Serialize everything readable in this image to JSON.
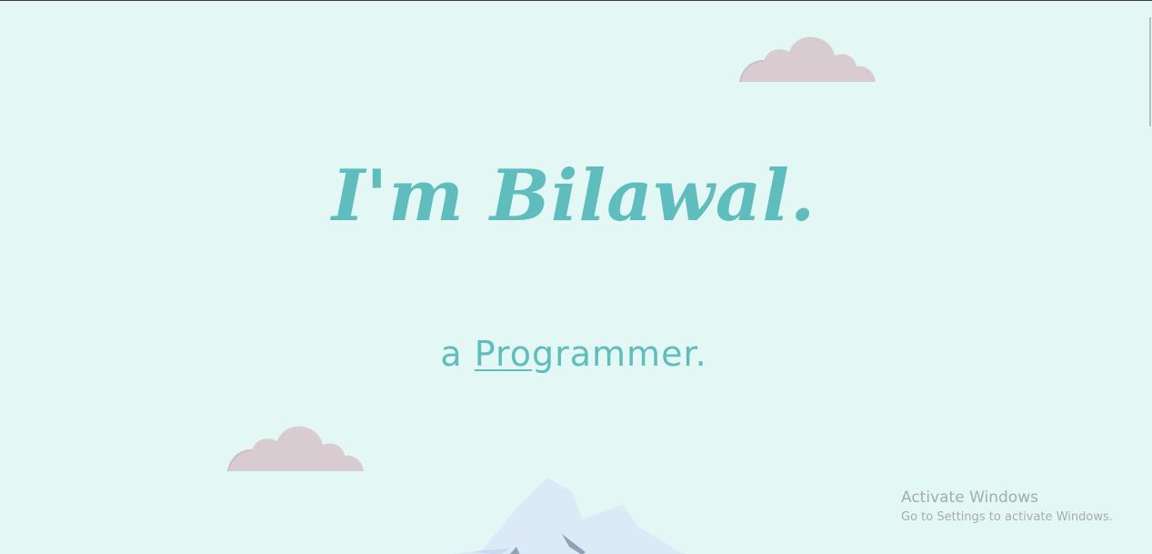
{
  "hero": {
    "title": "I'm Bilawal.",
    "subtitle_prefix": "a ",
    "subtitle_typed": "Pro",
    "subtitle_rest": "grammer."
  },
  "watermark": {
    "title": "Activate Windows",
    "subtitle": "Go to Settings to activate Windows."
  },
  "colors": {
    "background": "#e3f7f4",
    "accent": "#5fbdbd",
    "cloud": "#d9ccd1",
    "mountain": "#dce9f7"
  }
}
